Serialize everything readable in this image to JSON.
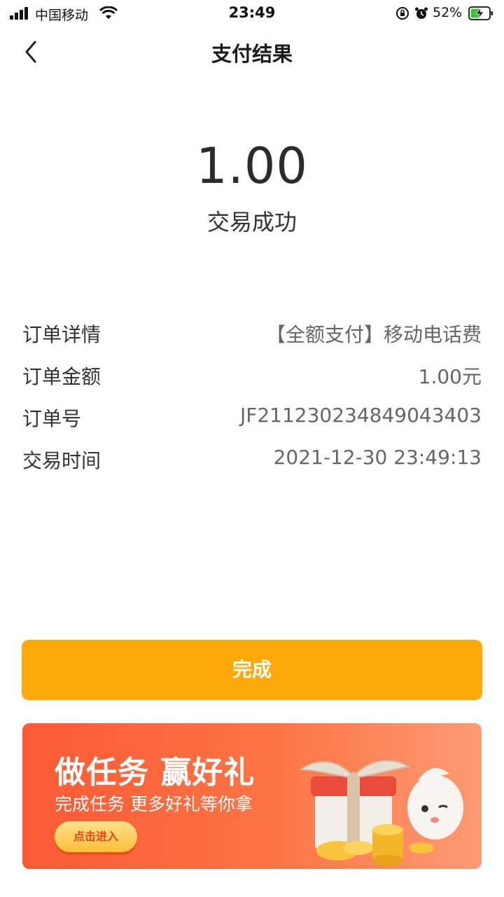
{
  "status_bar": {
    "carrier": "中国移动",
    "time": "23:49",
    "battery_percent": "52%"
  },
  "nav": {
    "title": "支付结果"
  },
  "result": {
    "amount": "1.00",
    "status": "交易成功"
  },
  "details": [
    {
      "label": "订单详情",
      "value": "【全额支付】移动电话费"
    },
    {
      "label": "订单金额",
      "value": "1.00元"
    },
    {
      "label": "订单号",
      "value": "JF21123023484904340​3"
    },
    {
      "label": "交易时间",
      "value": "2021-12-30 23:49:13"
    }
  ],
  "done_button": {
    "label": "完成"
  },
  "banner": {
    "title": "做任务 赢好礼",
    "subtitle": "完成任务 更多好礼等你拿",
    "button_label": "点击进入"
  },
  "colors": {
    "primary": "#fda90a",
    "banner_start": "#fc5a35",
    "banner_end": "#fd9a74",
    "battery_green": "#3cc13b"
  },
  "icons": [
    "signal-icon",
    "wifi-icon",
    "rotation-lock-icon",
    "alarm-icon",
    "battery-icon",
    "back-arrow-icon",
    "gift-icon",
    "mascot-icon",
    "coins-icon"
  ]
}
